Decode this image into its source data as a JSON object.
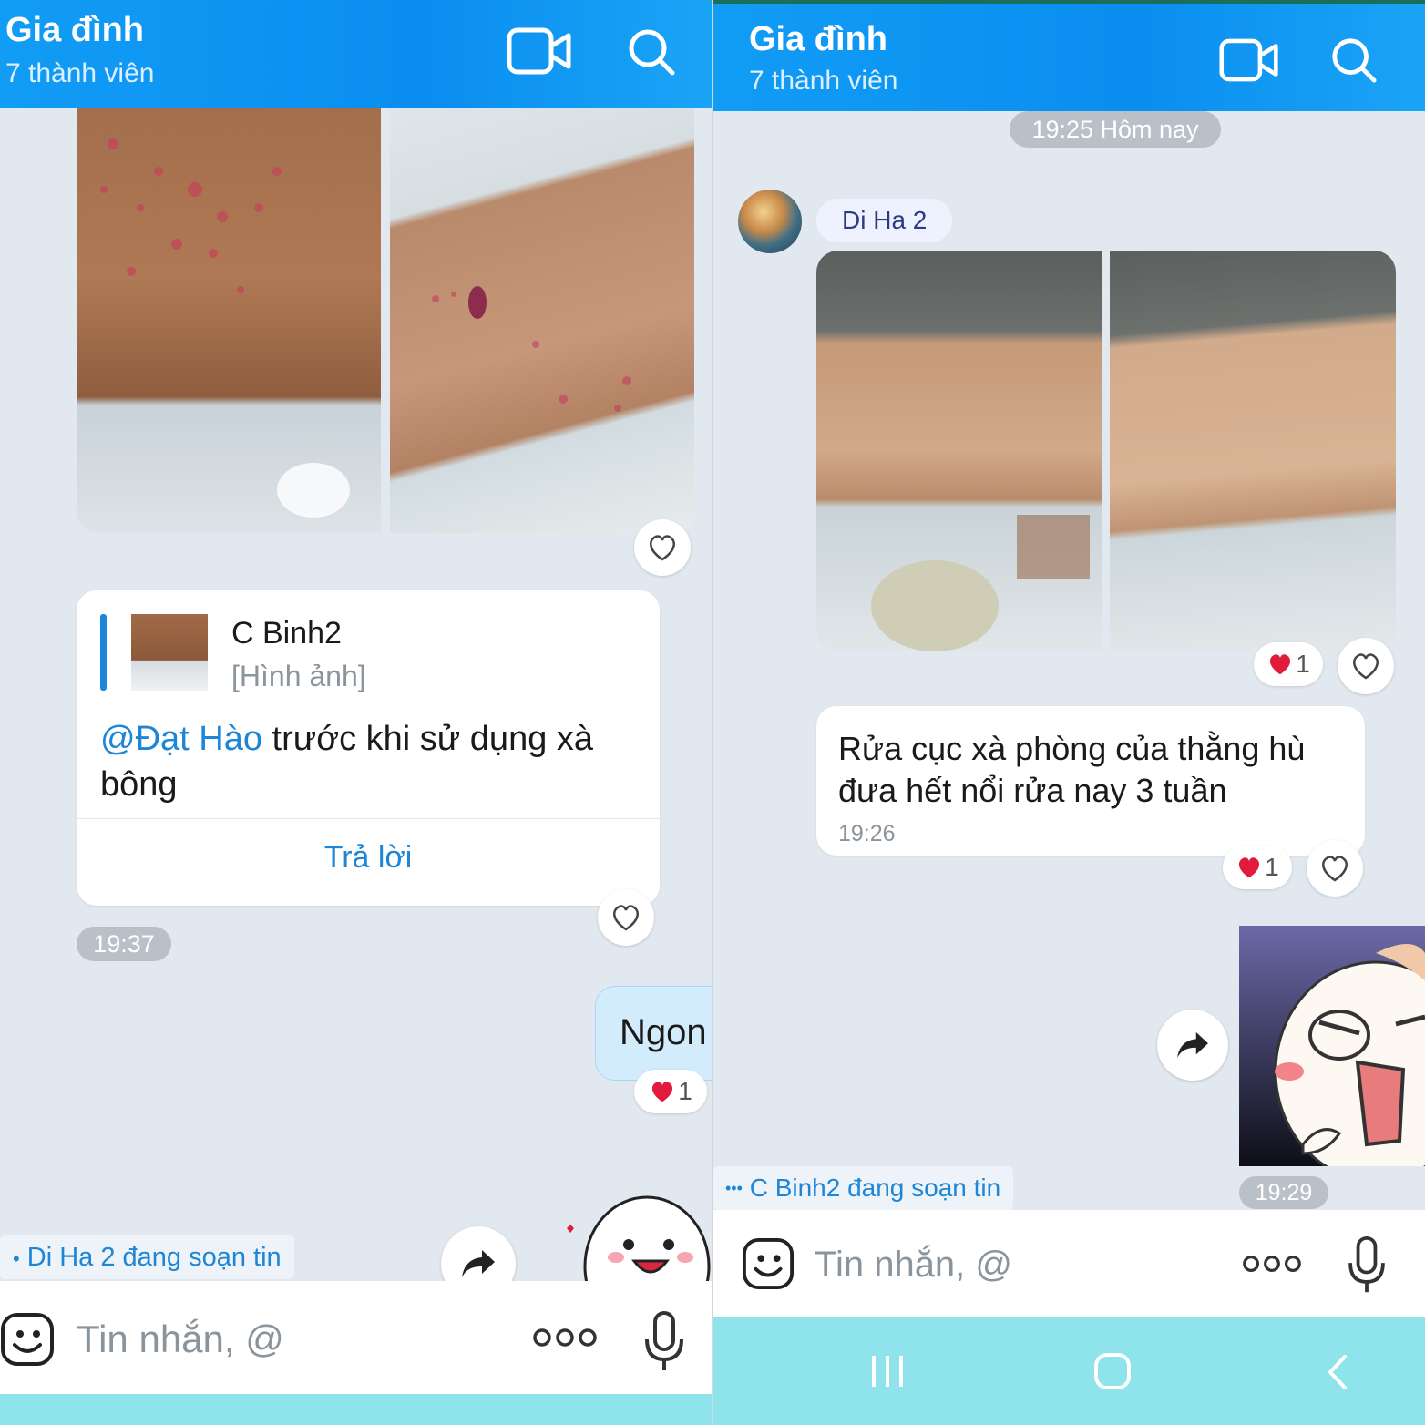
{
  "left": {
    "header": {
      "title": "Gia đình",
      "subtitle": "7 thành viên"
    },
    "quote": {
      "sender": "C Binh2",
      "quoted_type": "[Hình ảnh]",
      "mention": "@Đạt Hào",
      "message": " trước khi sử dụng xà bông",
      "reply_label": "Trả lời"
    },
    "time": "19:37",
    "outgoing": {
      "text": "Ngon",
      "reaction_count": "1"
    },
    "typing": "Di Ha 2 đang soạn tin",
    "composer": {
      "placeholder": "Tin nhắn, @"
    }
  },
  "right": {
    "header": {
      "title": "Gia đình",
      "subtitle": "7 thành viên"
    },
    "date_pill": "19:25 Hôm nay",
    "sender": "Di Ha 2",
    "photos_reaction_count": "1",
    "message": {
      "line1": "Rửa cục xà phòng của thằng hù",
      "line2": "đưa hết nổi rửa nay 3 tuần",
      "time": "19:26",
      "reaction_count": "1"
    },
    "sticker_time": "19:29",
    "typing": "C Binh2 đang soạn tin",
    "composer": {
      "placeholder": "Tin nhắn, @"
    }
  },
  "colors": {
    "accent": "#0a8ef0",
    "link": "#1d86d6",
    "heart": "#e01b3c",
    "navbar": "#8fe3ea"
  },
  "icons": [
    "video-call-icon",
    "search-icon",
    "heart-icon",
    "forward-icon",
    "emoji-icon",
    "more-icon",
    "microphone-icon",
    "recents-icon",
    "home-icon",
    "back-icon"
  ]
}
